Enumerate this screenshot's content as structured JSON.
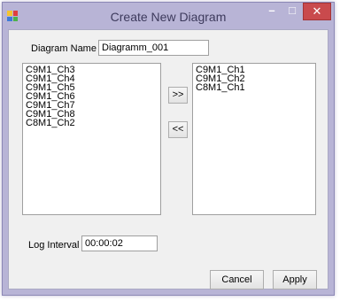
{
  "window": {
    "title": "Create New Diagram",
    "minimize_glyph": "–",
    "maximize_glyph": "□",
    "close_glyph": "✕"
  },
  "form": {
    "diagram_name_label": "Diagram Name",
    "diagram_name_value": "Diagramm_001",
    "log_interval_label": "Log Interval",
    "log_interval_value": "00:00:02"
  },
  "available_channels": [
    "C9M1_Ch3",
    "C9M1_Ch4",
    "C9M1_Ch5",
    "C9M1_Ch6",
    "C9M1_Ch7",
    "C9M1_Ch8",
    "C8M1_Ch2"
  ],
  "selected_channels": [
    "C9M1_Ch1",
    "C9M1_Ch2",
    "C8M1_Ch1"
  ],
  "buttons": {
    "add": ">>",
    "remove": "<<",
    "cancel": "Cancel",
    "apply": "Apply"
  },
  "icons": {
    "app_icon": "app-icon"
  }
}
